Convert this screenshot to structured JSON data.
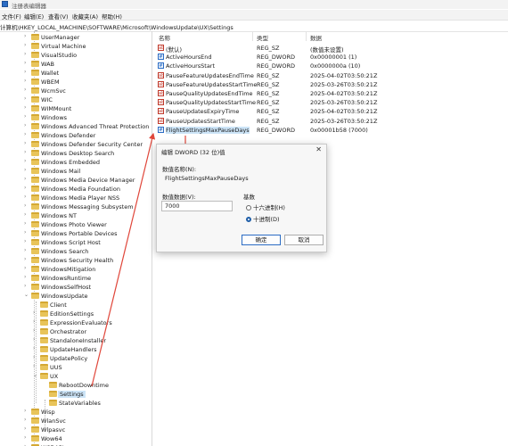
{
  "window": {
    "title": "注册表编辑器"
  },
  "menu": [
    "文件(F)",
    "编辑(E)",
    "查看(V)",
    "收藏夹(A)",
    "帮助(H)"
  ],
  "address": "计算机\\HKEY_LOCAL_MACHINE\\SOFTWARE\\Microsoft\\WindowsUpdate\\UX\\Settings",
  "tree": {
    "items": [
      "UserManager",
      "Virtual Machine",
      "VisualStudio",
      "WAB",
      "Wallet",
      "WBEM",
      "WcmSvc",
      "WIC",
      "WIMMount",
      "Windows",
      "Windows Advanced Threat Protection",
      "Windows Defender",
      "Windows Defender Security Center",
      "Windows Desktop Search",
      "Windows Embedded",
      "Windows Mail",
      "Windows Media Device Manager",
      "Windows Media Foundation",
      "Windows Media Player NSS",
      "Windows Messaging Subsystem",
      "Windows NT",
      "Windows Photo Viewer",
      "Windows Portable Devices",
      "Windows Script Host",
      "Windows Search",
      "Windows Security Health",
      "WindowsMitigation",
      "WindowsRuntime",
      "WindowsSelfHost",
      "WindowsUpdate",
      "Client",
      "EditionSettings",
      "ExpressionEvaluators",
      "Orchestrator",
      "StandaloneInstaller",
      "UpdateHandlers",
      "UpdatePolicy",
      "UUS",
      "UX",
      "RebootDowntime",
      "Settings",
      "StateVariables",
      "Wisp",
      "WlanSvc",
      "Wlpasvc",
      "Wow64",
      "WSDAPI"
    ]
  },
  "values": {
    "headers": {
      "name": "名称",
      "type": "类型",
      "data": "数据"
    },
    "rows": [
      {
        "name": "(默认)",
        "type": "REG_SZ",
        "data": "(数值未设置)",
        "icon": "string-value-icon"
      },
      {
        "name": "ActiveHoursEnd",
        "type": "REG_DWORD",
        "data": "0x00000001 (1)",
        "icon": "dword-value-icon"
      },
      {
        "name": "ActiveHoursStart",
        "type": "REG_DWORD",
        "data": "0x0000000a (10)",
        "icon": "dword-value-icon"
      },
      {
        "name": "PauseFeatureUpdatesEndTime",
        "type": "REG_SZ",
        "data": "2025-04-02T03:50:21Z",
        "icon": "string-value-icon"
      },
      {
        "name": "PauseFeatureUpdatesStartTime",
        "type": "REG_SZ",
        "data": "2025-03-26T03:50:21Z",
        "icon": "string-value-icon"
      },
      {
        "name": "PauseQualityUpdatesEndTime",
        "type": "REG_SZ",
        "data": "2025-04-02T03:50:21Z",
        "icon": "string-value-icon"
      },
      {
        "name": "PauseQualityUpdatesStartTime",
        "type": "REG_SZ",
        "data": "2025-03-26T03:50:21Z",
        "icon": "string-value-icon"
      },
      {
        "name": "PauseUpdatesExpiryTime",
        "type": "REG_SZ",
        "data": "2025-04-02T03:50:21Z",
        "icon": "string-value-icon"
      },
      {
        "name": "PauseUpdatesStartTime",
        "type": "REG_SZ",
        "data": "2025-03-26T03:50:21Z",
        "icon": "string-value-icon"
      },
      {
        "name": "FlightSettingsMaxPauseDays",
        "type": "REG_DWORD",
        "data": "0x00001b58 (7000)",
        "icon": "dword-value-icon"
      }
    ]
  },
  "dialog": {
    "title": "编辑 DWORD (32 位)值",
    "name_label": "数值名称(N):",
    "name_value": "FlightSettingsMaxPauseDays",
    "data_label": "数值数据(V):",
    "data_value": "7000",
    "base_label": "基数",
    "hex_label": "十六进制(H)",
    "dec_label": "十进制(D)",
    "selected_base": "dec",
    "ok": "确定",
    "cancel": "取消"
  },
  "colors": {
    "selection": "#cce4f7",
    "annotation_arrow": "#e0463a",
    "folder": "#e8c45a"
  }
}
